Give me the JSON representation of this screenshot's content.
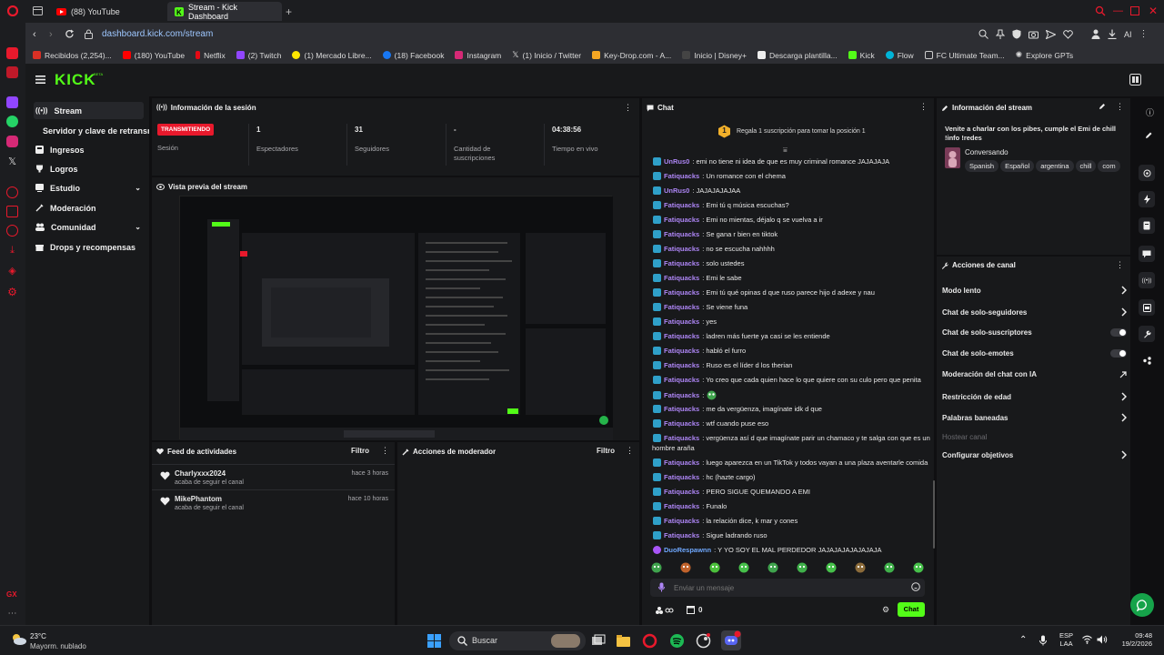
{
  "browser": {
    "tabs": [
      {
        "label": "(88) YouTube"
      },
      {
        "label": "Stream - Kick Dashboard"
      }
    ],
    "url_host": "dashboard.kick.com",
    "url_path": "/stream",
    "ai_label": "AI",
    "bookmarks": [
      "Recibidos (2,254)...",
      "(180) YouTube",
      "Netflix",
      "(2) Twitch",
      "(1) Mercado Libre...",
      "(18) Facebook",
      "Instagram",
      "(1) Inicio / Twitter",
      "Key-Drop.com - A...",
      "Inicio | Disney+",
      "Descarga plantilla...",
      "Kick",
      "Flow",
      "FC Ultimate Team...",
      "Explore GPTs"
    ]
  },
  "kick": {
    "logo": "KICK",
    "beta": "BETA"
  },
  "nav": {
    "items": [
      "Stream",
      "Servidor y clave de retransm",
      "Ingresos",
      "Logros",
      "Estudio",
      "Moderación",
      "Comunidad",
      "Drops y recompensas"
    ]
  },
  "session": {
    "title": "Información de la sesión",
    "status_badge": "TRANSMITIENDO",
    "status_label": "Sesión",
    "stats": [
      {
        "value": "1",
        "label": "Espectadores"
      },
      {
        "value": "31",
        "label": "Seguidores"
      },
      {
        "value": "-",
        "label": "Cantidad de suscripciones"
      },
      {
        "value": "04:38:56",
        "label": "Tiempo en vivo"
      }
    ]
  },
  "preview": {
    "title": "Vista previa del stream"
  },
  "feed": {
    "title": "Feed de actividades",
    "filter": "Filtro",
    "items": [
      {
        "user": "Charlyxxx2024",
        "action": "acaba de seguir el canal",
        "time": "hace 3 horas"
      },
      {
        "user": "MikePhantom",
        "action": "acaba de seguir el canal",
        "time": "hace 10 horas"
      }
    ]
  },
  "modactions": {
    "title": "Acciones de moderador",
    "filter": "Filtro"
  },
  "chat": {
    "title": "Chat",
    "gift_count": "1",
    "gift_text": "Regala 1 suscripción para tomar la posición 1",
    "messages": [
      {
        "user": "UnRus0",
        "text": ": emi no tiene ni idea de que es muy criminal romance JAJAJAJA"
      },
      {
        "user": "Fatiquacks",
        "text": ": Un romance con el chema"
      },
      {
        "user": "UnRus0",
        "text": ": JAJAJAJAJAA"
      },
      {
        "user": "Fatiquacks",
        "text": ": Emi tú q música escuchas?"
      },
      {
        "user": "Fatiquacks",
        "text": ": Emi no mientas, déjalo q se vuelva a ir"
      },
      {
        "user": "Fatiquacks",
        "text": ": Se gana r bien en tiktok"
      },
      {
        "user": "Fatiquacks",
        "text": ": no se escucha nahhhh"
      },
      {
        "user": "Fatiquacks",
        "text": ": solo ustedes"
      },
      {
        "user": "Fatiquacks",
        "text": ": Emi le sabe"
      },
      {
        "user": "Fatiquacks",
        "text": ": Emi tú qué opinas d que ruso parece hijo d adexe y nau"
      },
      {
        "user": "Fatiquacks",
        "text": ": Se viene funa"
      },
      {
        "user": "Fatiquacks",
        "text": ": yes"
      },
      {
        "user": "Fatiquacks",
        "text": ": ladren más fuerte ya casi se les entiende"
      },
      {
        "user": "Fatiquacks",
        "text": ": habló el furro"
      },
      {
        "user": "Fatiquacks",
        "text": ": Ruso es el líder d los therian"
      },
      {
        "user": "Fatiquacks",
        "text": ": Yo creo que cada quien hace lo que quiere con su culo pero que penita"
      },
      {
        "user": "Fatiquacks",
        "text": ":"
      },
      {
        "user": "Fatiquacks",
        "text": ": me da vergüenza, imagínate idk d que"
      },
      {
        "user": "Fatiquacks",
        "text": ": wtf cuando puse eso"
      },
      {
        "user": "Fatiquacks",
        "text": ": vergüenza así d que imagínate parir un chamaco y te salga con que es un"
      },
      {
        "user": "Fatiquacks",
        "text": ": luego aparezca en un TikTok y todos vayan a una plaza aventarle comida"
      },
      {
        "user": "Fatiquacks",
        "text": ": hc (hazte cargo)"
      },
      {
        "user": "Fatiquacks",
        "text": ": PERO SIGUE QUEMANDO A EMI"
      },
      {
        "user": "Fatiquacks",
        "text": ": Funalo"
      },
      {
        "user": "Fatiquacks",
        "text": ": la relación dice, k mar y cones"
      },
      {
        "user": "Fatiquacks",
        "text": ": Sigue ladrando ruso"
      },
      {
        "user": "DuoRespawnn",
        "text": ": Y YO SOY EL MAL PERDEDOR JAJAJAJAJAJAJAJA"
      }
    ],
    "wrap_tail": "hombre araña",
    "input_placeholder": "Enviar un mensaje",
    "points": "0",
    "send": "Chat"
  },
  "streaminfo": {
    "title": "Información del stream",
    "stream_title": "Venite a charlar con los pibes, cumple el Emi de chill !info !redes",
    "category": "Conversando",
    "tags": [
      "Spanish",
      "Español",
      "argentina",
      "chill",
      "com"
    ]
  },
  "channel": {
    "title": "Acciones de canal",
    "rows": [
      {
        "label": "Modo lento",
        "control": "chevron"
      },
      {
        "label": "Chat de solo-seguidores",
        "control": "chevron"
      },
      {
        "label": "Chat de solo-suscriptores",
        "control": "toggle"
      },
      {
        "label": "Chat de solo-emotes",
        "control": "toggle"
      },
      {
        "label": "Moderación del chat con IA",
        "control": "external"
      },
      {
        "label": "Restricción de edad",
        "control": "chevron"
      },
      {
        "label": "Palabras baneadas",
        "control": "chevron"
      },
      {
        "label": "Hostear canal",
        "control": "disabled"
      },
      {
        "label": "Configurar objetivos",
        "control": "chevron"
      }
    ]
  },
  "taskbar": {
    "weather_temp": "23°C",
    "weather_desc": "Mayorm. nublado",
    "search": "Buscar",
    "lang1": "ESP",
    "lang2": "LAA",
    "time": "09:48",
    "date": "19/2/2026"
  },
  "colors": {
    "kick_green": "#53fc18",
    "live_red": "#e8192c",
    "user_purple": "#ad85f5"
  }
}
